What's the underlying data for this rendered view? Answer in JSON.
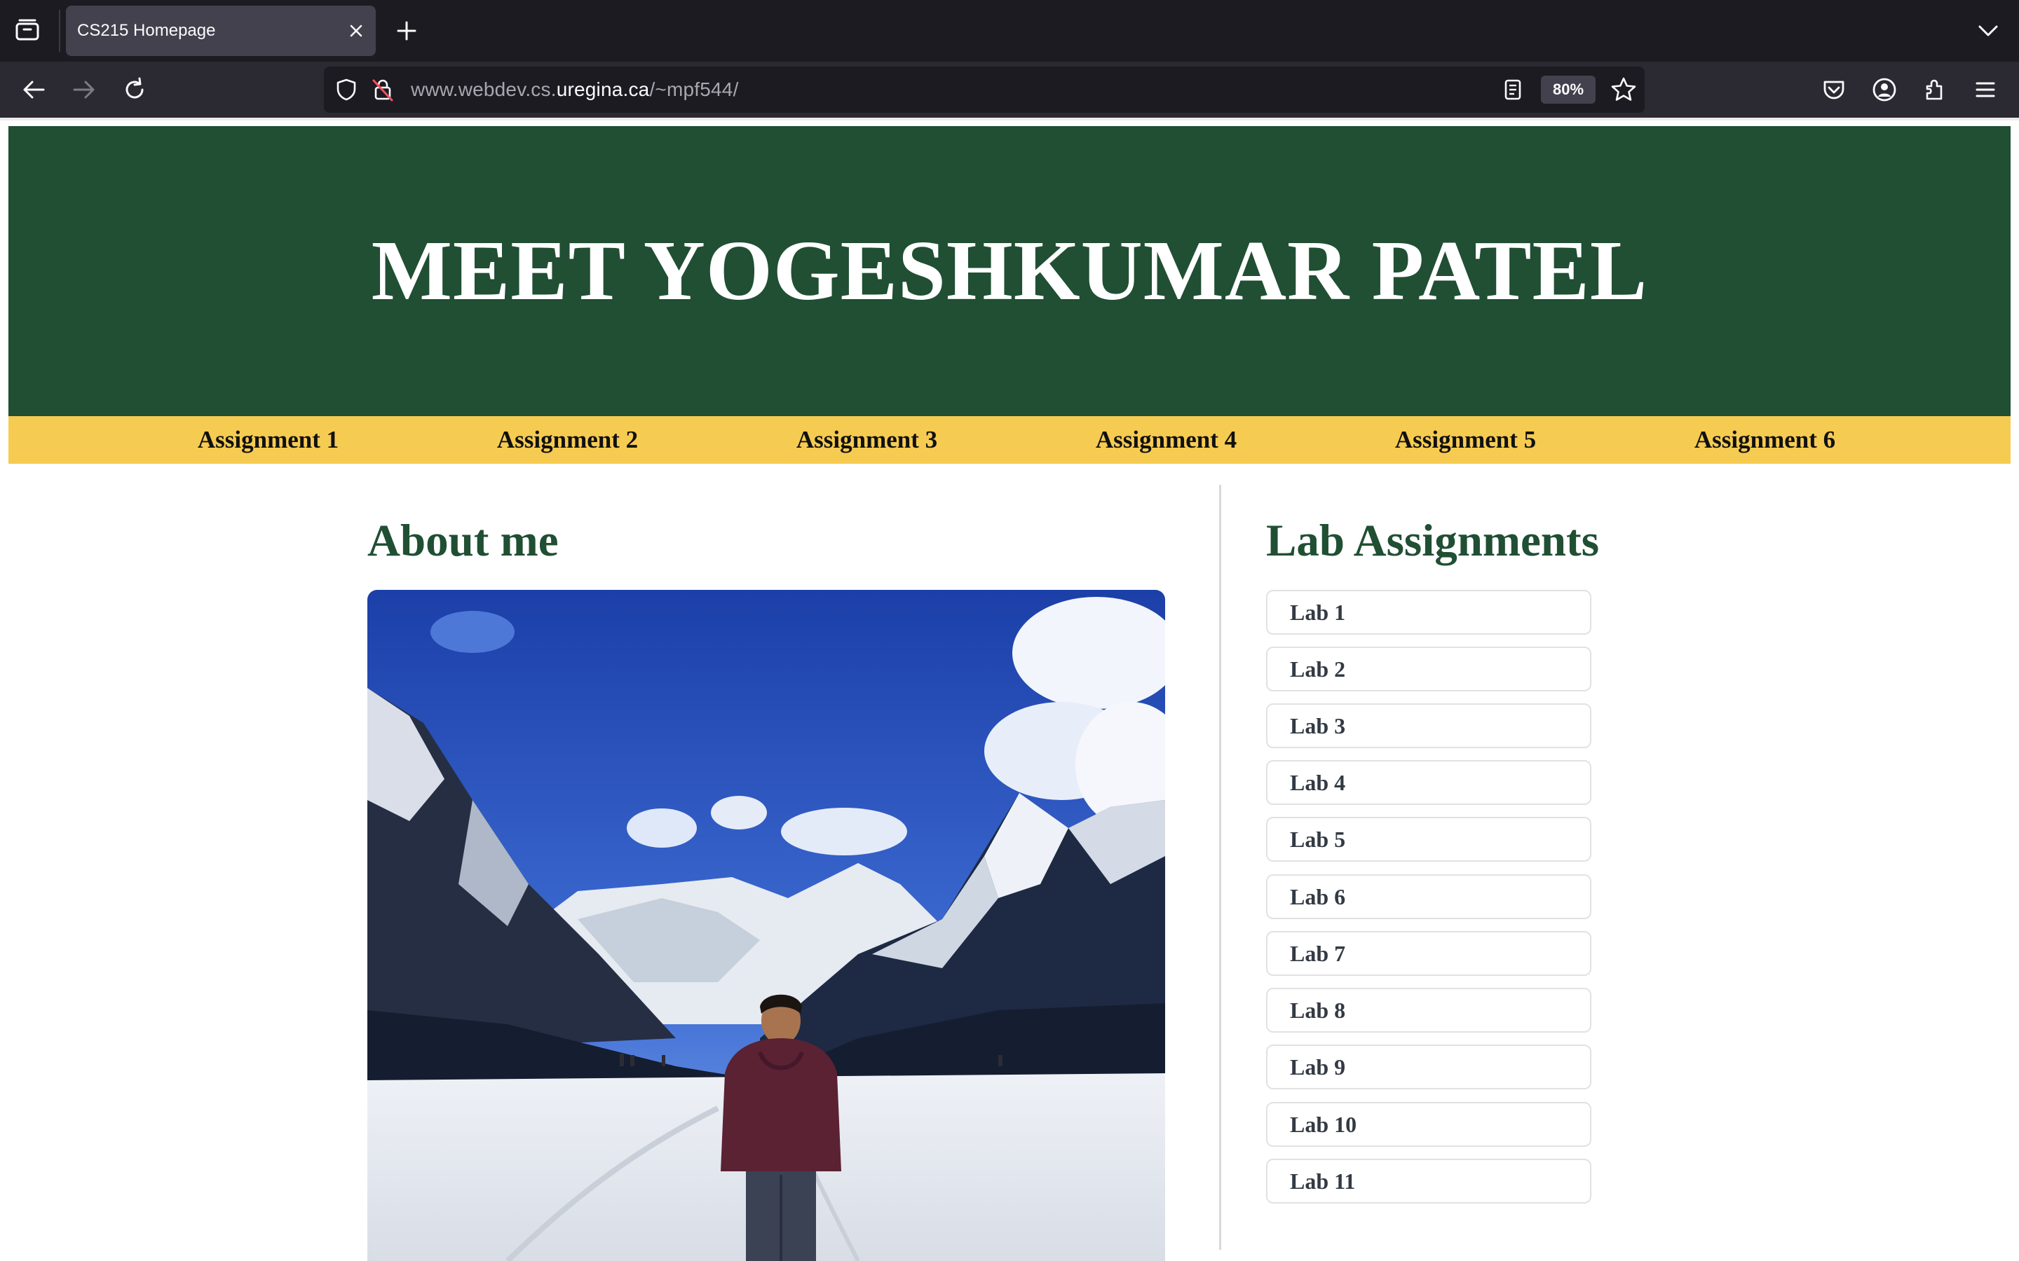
{
  "browser": {
    "tab_title": "CS215 Homepage",
    "url_prefix": "www.webdev.cs.",
    "url_domain": "uregina.ca",
    "url_path": "/~mpf544/",
    "zoom": "80%",
    "icons": [
      "tab-overview-icon",
      "close-icon",
      "plus-icon",
      "chevron-down-icon",
      "back-arrow-icon",
      "forward-arrow-icon",
      "reload-icon",
      "shield-icon",
      "insecure-lock-icon",
      "reader-view-icon",
      "star-icon",
      "pocket-icon",
      "account-icon",
      "extensions-icon",
      "menu-icon"
    ]
  },
  "header": {
    "title": "MEET YOGESHKUMAR PATEL",
    "background": "#204f33"
  },
  "assignments": [
    {
      "label": "Assignment 1"
    },
    {
      "label": "Assignment 2"
    },
    {
      "label": "Assignment 3"
    },
    {
      "label": "Assignment 4"
    },
    {
      "label": "Assignment 5"
    },
    {
      "label": "Assignment 6"
    }
  ],
  "nav_color": "#f6cb51",
  "about": {
    "title": "About me",
    "photo_subject": "person standing on snowy frozen lake with mountains and blue sky"
  },
  "labs": {
    "title": "Lab Assignments",
    "items": [
      {
        "label": "Lab 1"
      },
      {
        "label": "Lab 2"
      },
      {
        "label": "Lab 3"
      },
      {
        "label": "Lab 4"
      },
      {
        "label": "Lab 5"
      },
      {
        "label": "Lab 6"
      },
      {
        "label": "Lab 7"
      },
      {
        "label": "Lab 8"
      },
      {
        "label": "Lab 9"
      },
      {
        "label": "Lab 10"
      },
      {
        "label": "Lab 11"
      }
    ]
  }
}
